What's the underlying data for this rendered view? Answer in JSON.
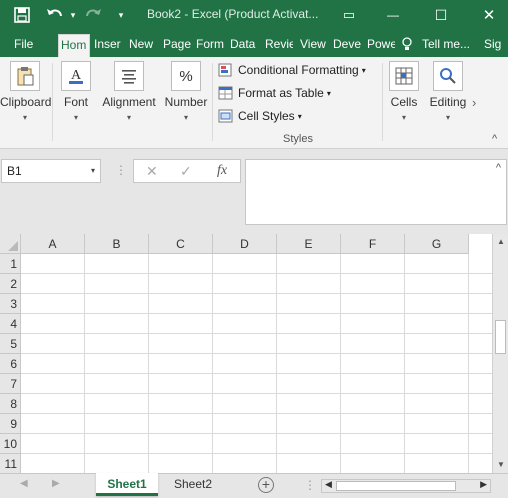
{
  "titlebar": {
    "title": "Book2 - Excel (Product Activat...",
    "save_icon": "save-icon",
    "undo_icon": "undo-icon",
    "redo_icon": "redo-icon",
    "qat_more": "▾",
    "minimize": "—",
    "maximize": "☐",
    "close": "✕",
    "ribbon_options": "▭"
  },
  "tabs": [
    {
      "label": "File"
    },
    {
      "label": "Hom"
    },
    {
      "label": "Inser"
    },
    {
      "label": "New"
    },
    {
      "label": "Page"
    },
    {
      "label": "Form"
    },
    {
      "label": "Data"
    },
    {
      "label": "Revie"
    },
    {
      "label": "View"
    },
    {
      "label": "Deve"
    },
    {
      "label": "Powe"
    },
    {
      "label": "Tell me..."
    },
    {
      "label": "Sig"
    }
  ],
  "ribbon": {
    "clipboard": "Clipboard",
    "font": "Font",
    "alignment": "Alignment",
    "number": "Number",
    "number_symbol": "%",
    "conditional_formatting": "Conditional Formatting",
    "format_as_table": "Format as Table",
    "cell_styles": "Cell Styles",
    "styles_group": "Styles",
    "cells": "Cells",
    "editing": "Editing",
    "caret": "▾",
    "more_arrow": "›",
    "collapse": "^"
  },
  "formula_bar": {
    "name_box": "B1",
    "cancel": "✕",
    "enter": "✓",
    "fx": "fx",
    "expand": "^"
  },
  "grid": {
    "columns": [
      "A",
      "B",
      "C",
      "D",
      "E",
      "F",
      "G"
    ],
    "rows": [
      "1",
      "2",
      "3",
      "4",
      "5",
      "6",
      "7",
      "8",
      "9",
      "10",
      "11"
    ]
  },
  "sheets": [
    {
      "label": "Sheet1",
      "active": true
    },
    {
      "label": "Sheet2",
      "active": false
    }
  ],
  "sheetbar": {
    "add": "+",
    "prev": "◀",
    "next": "▶",
    "ellipsis": "⋮"
  },
  "colors": {
    "accent": "#217346",
    "ribbon_bg": "#f3f3f3",
    "gridline": "#dadada"
  }
}
